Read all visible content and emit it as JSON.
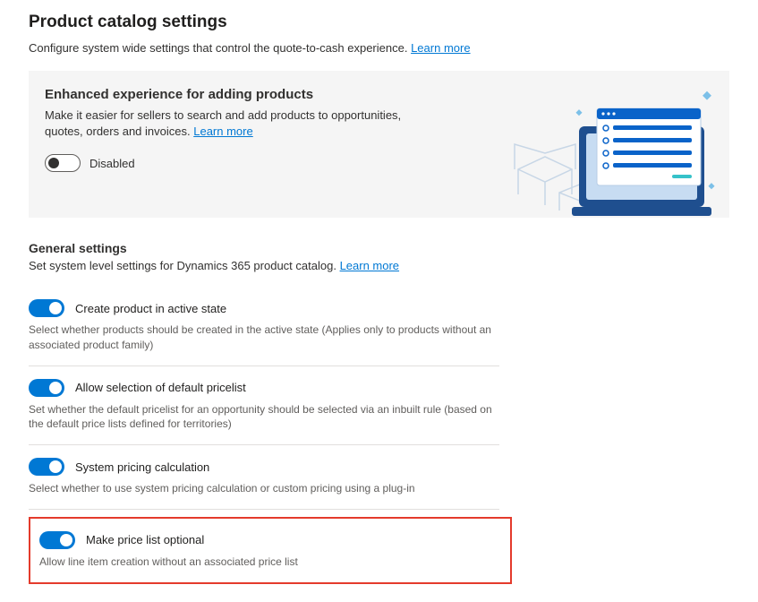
{
  "page": {
    "title": "Product catalog settings",
    "description": "Configure system wide settings that control the quote-to-cash experience.",
    "learn_more": "Learn more"
  },
  "enhanced": {
    "title": "Enhanced experience for adding products",
    "description": "Make it easier for sellers to search and add products to opportunities, quotes, orders and invoices.",
    "learn_more": "Learn more",
    "toggle_label": "Disabled"
  },
  "general": {
    "title": "General settings",
    "description": "Set system level settings for Dynamics 365 product catalog.",
    "learn_more": "Learn more"
  },
  "settings": [
    {
      "label": "Create product in active state",
      "description": "Select whether products should be created in the active state (Applies only to products without an associated product family)"
    },
    {
      "label": "Allow selection of default pricelist",
      "description": "Set whether the default pricelist for an opportunity should be selected via an inbuilt rule (based on the default price lists defined for territories)"
    },
    {
      "label": "System pricing calculation",
      "description": "Select whether to use system pricing calculation or custom pricing using a plug-in"
    },
    {
      "label": "Make price list optional",
      "description": "Allow line item creation without an associated price list"
    }
  ]
}
